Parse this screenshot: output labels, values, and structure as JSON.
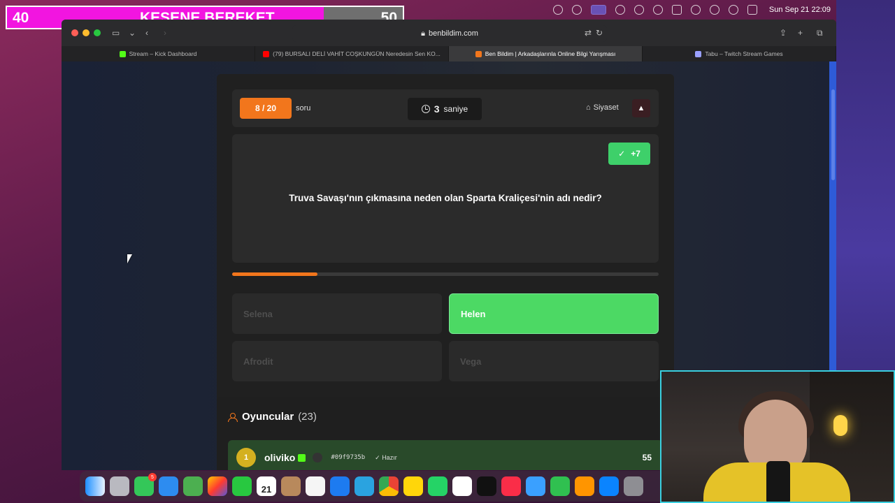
{
  "score_overlay": {
    "left": "40",
    "title": "KESENE BEREKET",
    "right": "50",
    "progress": 0.8
  },
  "menubar": {
    "datetime": "Sun Sep 21  22:09"
  },
  "browser": {
    "url": "benbildim.com",
    "tabs": [
      {
        "label": "Stream – Kick Dashboard",
        "favicon_color": "#53fc18"
      },
      {
        "label": "(79) BURSALI DELİ VAHİT COŞKUNGÜN Neredesin Sen KO...",
        "favicon_color": "#ff0000"
      },
      {
        "label": "Ben Bildim | Arkadaşlarınla Online Bilgi Yarışması",
        "favicon_color": "#f2761c"
      },
      {
        "label": "Tabu – Twitch Stream Games",
        "favicon_color": "#9aa0ff"
      }
    ]
  },
  "game": {
    "counter": "8 / 20",
    "counter_label": "soru",
    "timer_value": "3",
    "timer_unit": "saniye",
    "category": "Siyaset",
    "points": "+7",
    "question": "Truva Savaşı'nın çıkmasına neden olan Sparta Kraliçesi'nin adı nedir?",
    "progress": 0.2,
    "answers": [
      {
        "label": "Selena",
        "correct": false
      },
      {
        "label": "Helen",
        "correct": true
      },
      {
        "label": "Afrodit",
        "correct": false
      },
      {
        "label": "Vega",
        "correct": false
      }
    ]
  },
  "players": {
    "title": "Oyuncular",
    "count": "(23)",
    "rows": [
      {
        "rank": "1",
        "name": "oliviko",
        "hash": "#09f9735b",
        "status": "Hazır",
        "score": "55"
      }
    ]
  },
  "dock": {
    "calendar_month": "SEP",
    "calendar_day": "21",
    "messages_badge": "5"
  },
  "colors": {
    "accent": "#f2761c",
    "correct": "#4cd964",
    "overlay": "#f215e0"
  }
}
